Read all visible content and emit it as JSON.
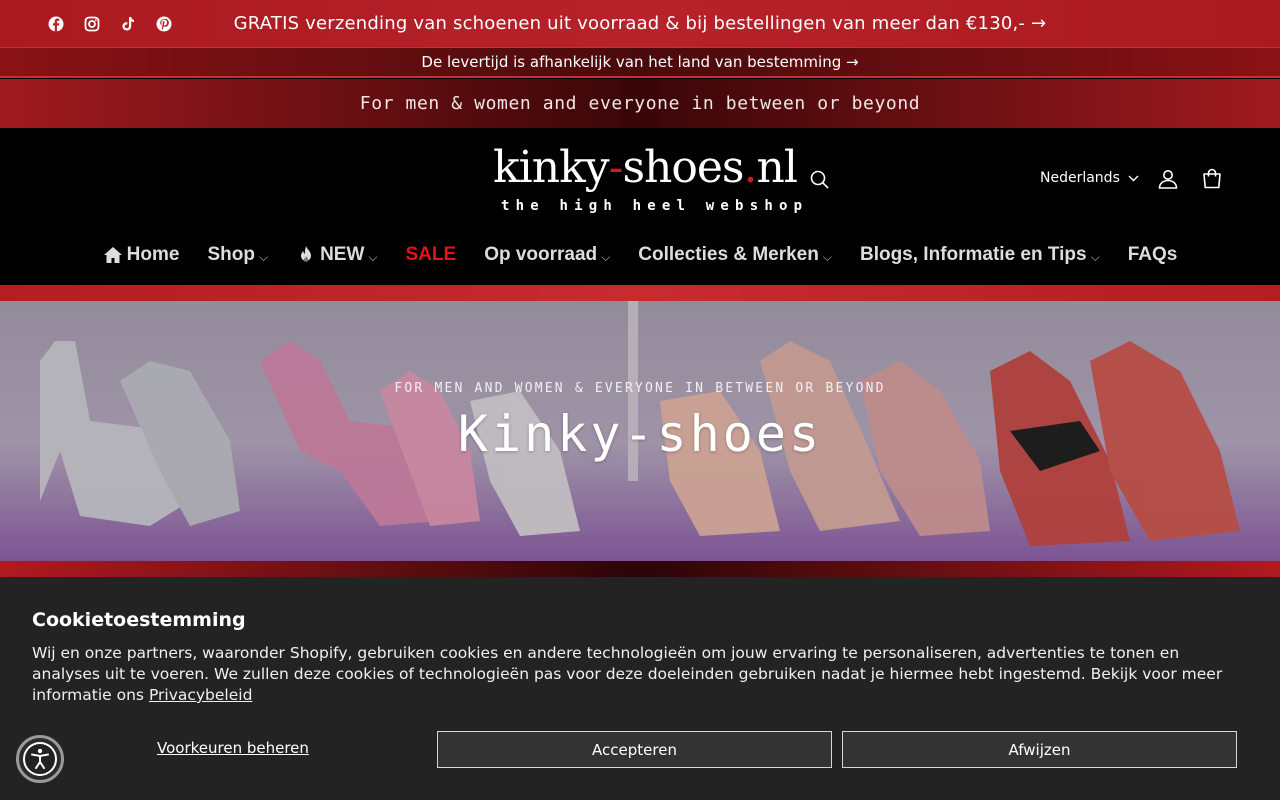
{
  "announcements": {
    "shipping": "GRATIS verzending van schoenen uit voorraad & bij bestellingen van meer dan €130,- →",
    "delivery": "De levertijd is afhankelijk van het land van bestemming →",
    "tagline": "For men & women and everyone in between or beyond"
  },
  "social": {
    "icons": [
      "facebook-icon",
      "instagram-icon",
      "tiktok-icon",
      "pinterest-icon"
    ]
  },
  "header": {
    "logo_part1": "kinky",
    "logo_dash": "-",
    "logo_part2": "shoes",
    "logo_dot": ".",
    "logo_part3": "nl",
    "logo_sub": "the high heel webshop",
    "language": "Nederlands"
  },
  "nav": {
    "home": "Home",
    "shop": "Shop",
    "new": "NEW",
    "sale": "SALE",
    "stock": "Op voorraad",
    "collections": "Collecties & Merken",
    "blogs": "Blogs, Informatie en Tips",
    "faqs": "FAQs",
    "chevron": "⌵"
  },
  "hero": {
    "subtitle": "FOR MEN AND WOMEN & EVERYONE IN BETWEEN OR BEYOND",
    "title": "Kinky-shoes"
  },
  "cookie": {
    "title": "Cookietoestemming",
    "text": "Wij en onze partners, waaronder Shopify, gebruiken cookies en andere technologieën om jouw ervaring te personaliseren, advertenties te tonen en analyses uit te voeren. We zullen deze cookies of technologieën pas voor deze doeleinden gebruiken nadat je hiermee hebt ingestemd. Bekijk voor meer informatie ons ",
    "link": "Privacybeleid",
    "prefs": "Voorkeuren beheren",
    "accept": "Accepteren",
    "reject": "Afwijzen"
  },
  "colors": {
    "brand_red": "#b8222a",
    "sale_red": "#e3131a",
    "header_bg": "#000000",
    "cookie_bg": "#232323"
  }
}
